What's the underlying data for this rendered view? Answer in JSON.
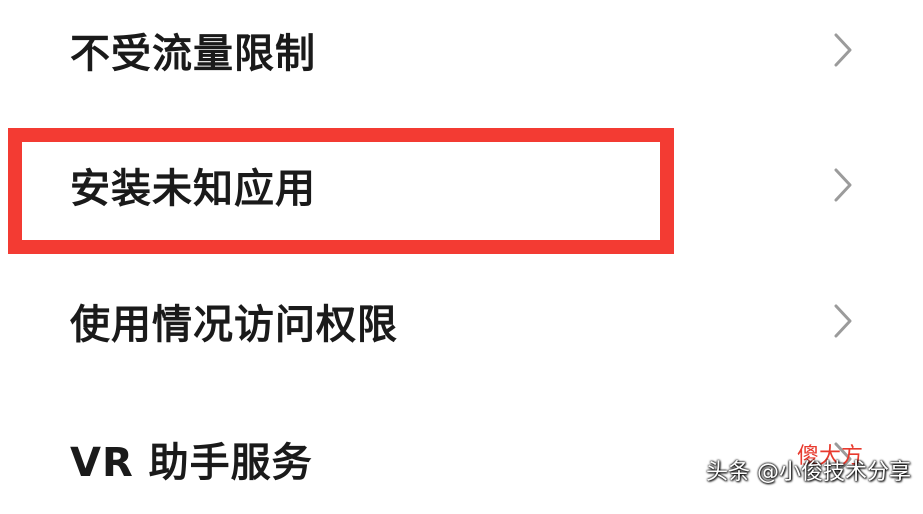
{
  "menu": {
    "items": [
      {
        "label": "不受流量限制"
      },
      {
        "label": "安装未知应用"
      },
      {
        "label": "使用情况访问权限"
      },
      {
        "label": "VR 助手服务"
      }
    ]
  },
  "watermark": {
    "text": "头条 @小俊技术分享",
    "overlay_text": "傻大方"
  },
  "colors": {
    "highlight": "#f33b33",
    "chevron": "#9b9b9b",
    "text": "#1a1a1a"
  }
}
